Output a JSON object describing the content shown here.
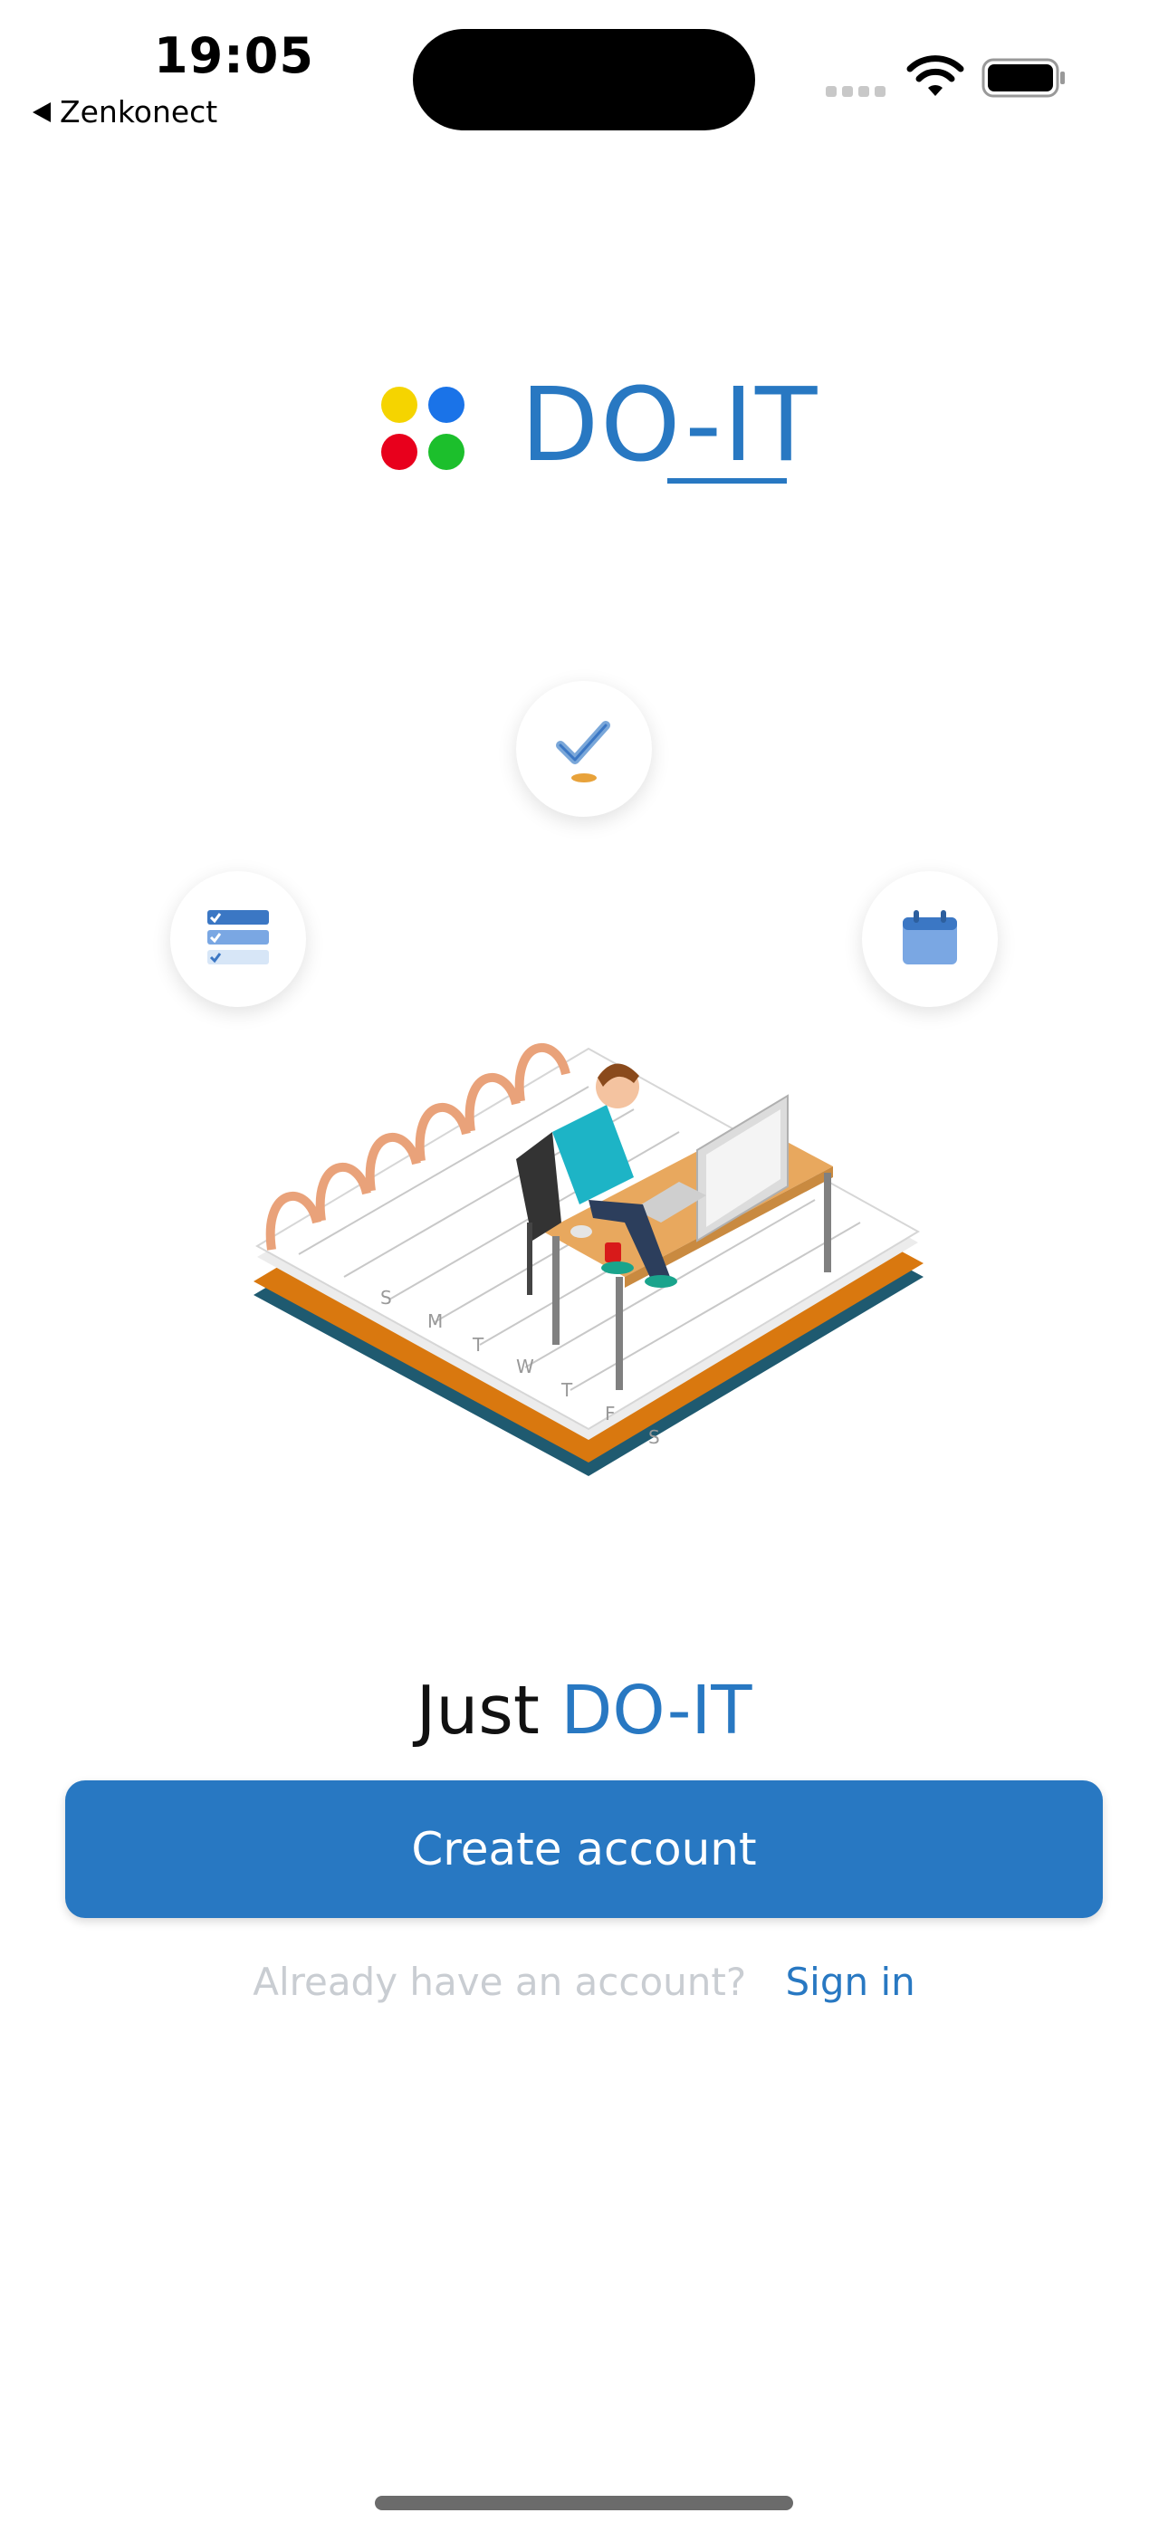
{
  "status_bar": {
    "time": "19:05",
    "back_app": "Zenkonect"
  },
  "logo": {
    "text": "DO-IT",
    "dot_colors": [
      "#f5d400",
      "#1a73e8",
      "#e8001c",
      "#1cbf2c"
    ]
  },
  "illustration": {
    "icons": [
      "checkmark-icon",
      "list-icon",
      "calendar-icon"
    ],
    "calendar_days": [
      "S",
      "M",
      "T",
      "W",
      "T",
      "F",
      "S"
    ]
  },
  "tagline": {
    "prefix": "Just",
    "brand": "DO-IT"
  },
  "actions": {
    "create_account_label": "Create account",
    "already_have_account": "Already have an account?",
    "sign_in_label": "Sign in"
  },
  "colors": {
    "brand_blue": "#2878c2",
    "muted_text": "#c9cdd2"
  }
}
